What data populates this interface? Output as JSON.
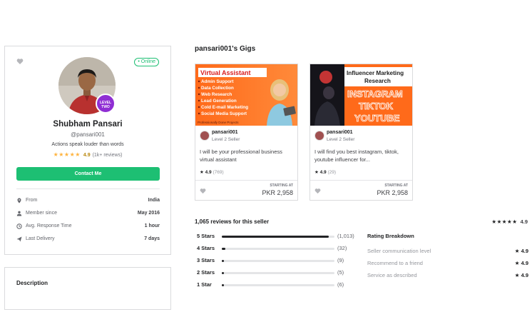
{
  "profile": {
    "online": "• Online",
    "name": "Shubham Pansari",
    "username": "@pansari001",
    "tagline": "Actions speak louder than words",
    "stars": "★★★★★",
    "rating": "4.9",
    "rating_count": "(1k+ reviews)",
    "level_line1": "LEVEL",
    "level_line2": "TWO",
    "contact_label": "Contact Me",
    "stats": [
      {
        "icon": "location-pin-icon",
        "label": "From",
        "value": "India"
      },
      {
        "icon": "user-icon",
        "label": "Member since",
        "value": "May 2016"
      },
      {
        "icon": "clock-icon",
        "label": "Avg. Response Time",
        "value": "1 hour"
      },
      {
        "icon": "send-icon",
        "label": "Last Delivery",
        "value": "7 days"
      }
    ],
    "description_title": "Description"
  },
  "gigs": {
    "title": "pansari001's Gigs",
    "items": [
      {
        "image_title": "Virtual Assistant",
        "image_bullets": [
          "Admin Support",
          "Data Collection",
          "Web Research",
          "Lead Generation",
          "Cold E-mail Marketing",
          "Social Media Support"
        ],
        "image_footer": "Professionally Done Projects",
        "seller": "pansari001",
        "level": "Level 2 Seller",
        "description": "I will be your professional business virtual assistant",
        "star": "★",
        "rating": "4.9",
        "count": "(769)",
        "starting": "STARTING AT",
        "price": "PKR 2,958"
      },
      {
        "image_title": "Influencer Marketing Research",
        "image_lines": [
          "INSTAGRAM",
          "TIKTOK",
          "YOUTUBE"
        ],
        "seller": "pansari001",
        "level": "Level 2 Seller",
        "description": "I will find you best instagram, tiktok, youtube influencer for...",
        "star": "★",
        "rating": "4.9",
        "count": "(29)",
        "starting": "STARTING AT",
        "price": "PKR 2,958"
      }
    ]
  },
  "reviews": {
    "count_label": "1,065 reviews for this seller",
    "overall_stars": "★★★★★",
    "overall_rating": "4.9",
    "bars": [
      {
        "label": "5 Stars",
        "count": "(1,013)",
        "fraction": 0.951
      },
      {
        "label": "4 Stars",
        "count": "(32)",
        "fraction": 0.03
      },
      {
        "label": "3 Stars",
        "count": "(9)",
        "fraction": 0.008
      },
      {
        "label": "2 Stars",
        "count": "(5)",
        "fraction": 0.005
      },
      {
        "label": "1 Star",
        "count": "(6)",
        "fraction": 0.006
      }
    ],
    "breakdown_title": "Rating Breakdown",
    "breakdown": [
      {
        "label": "Seller communication level",
        "value": "★ 4.9"
      },
      {
        "label": "Recommend to a friend",
        "value": "★ 4.9"
      },
      {
        "label": "Service as described",
        "value": "★ 4.9"
      }
    ]
  }
}
